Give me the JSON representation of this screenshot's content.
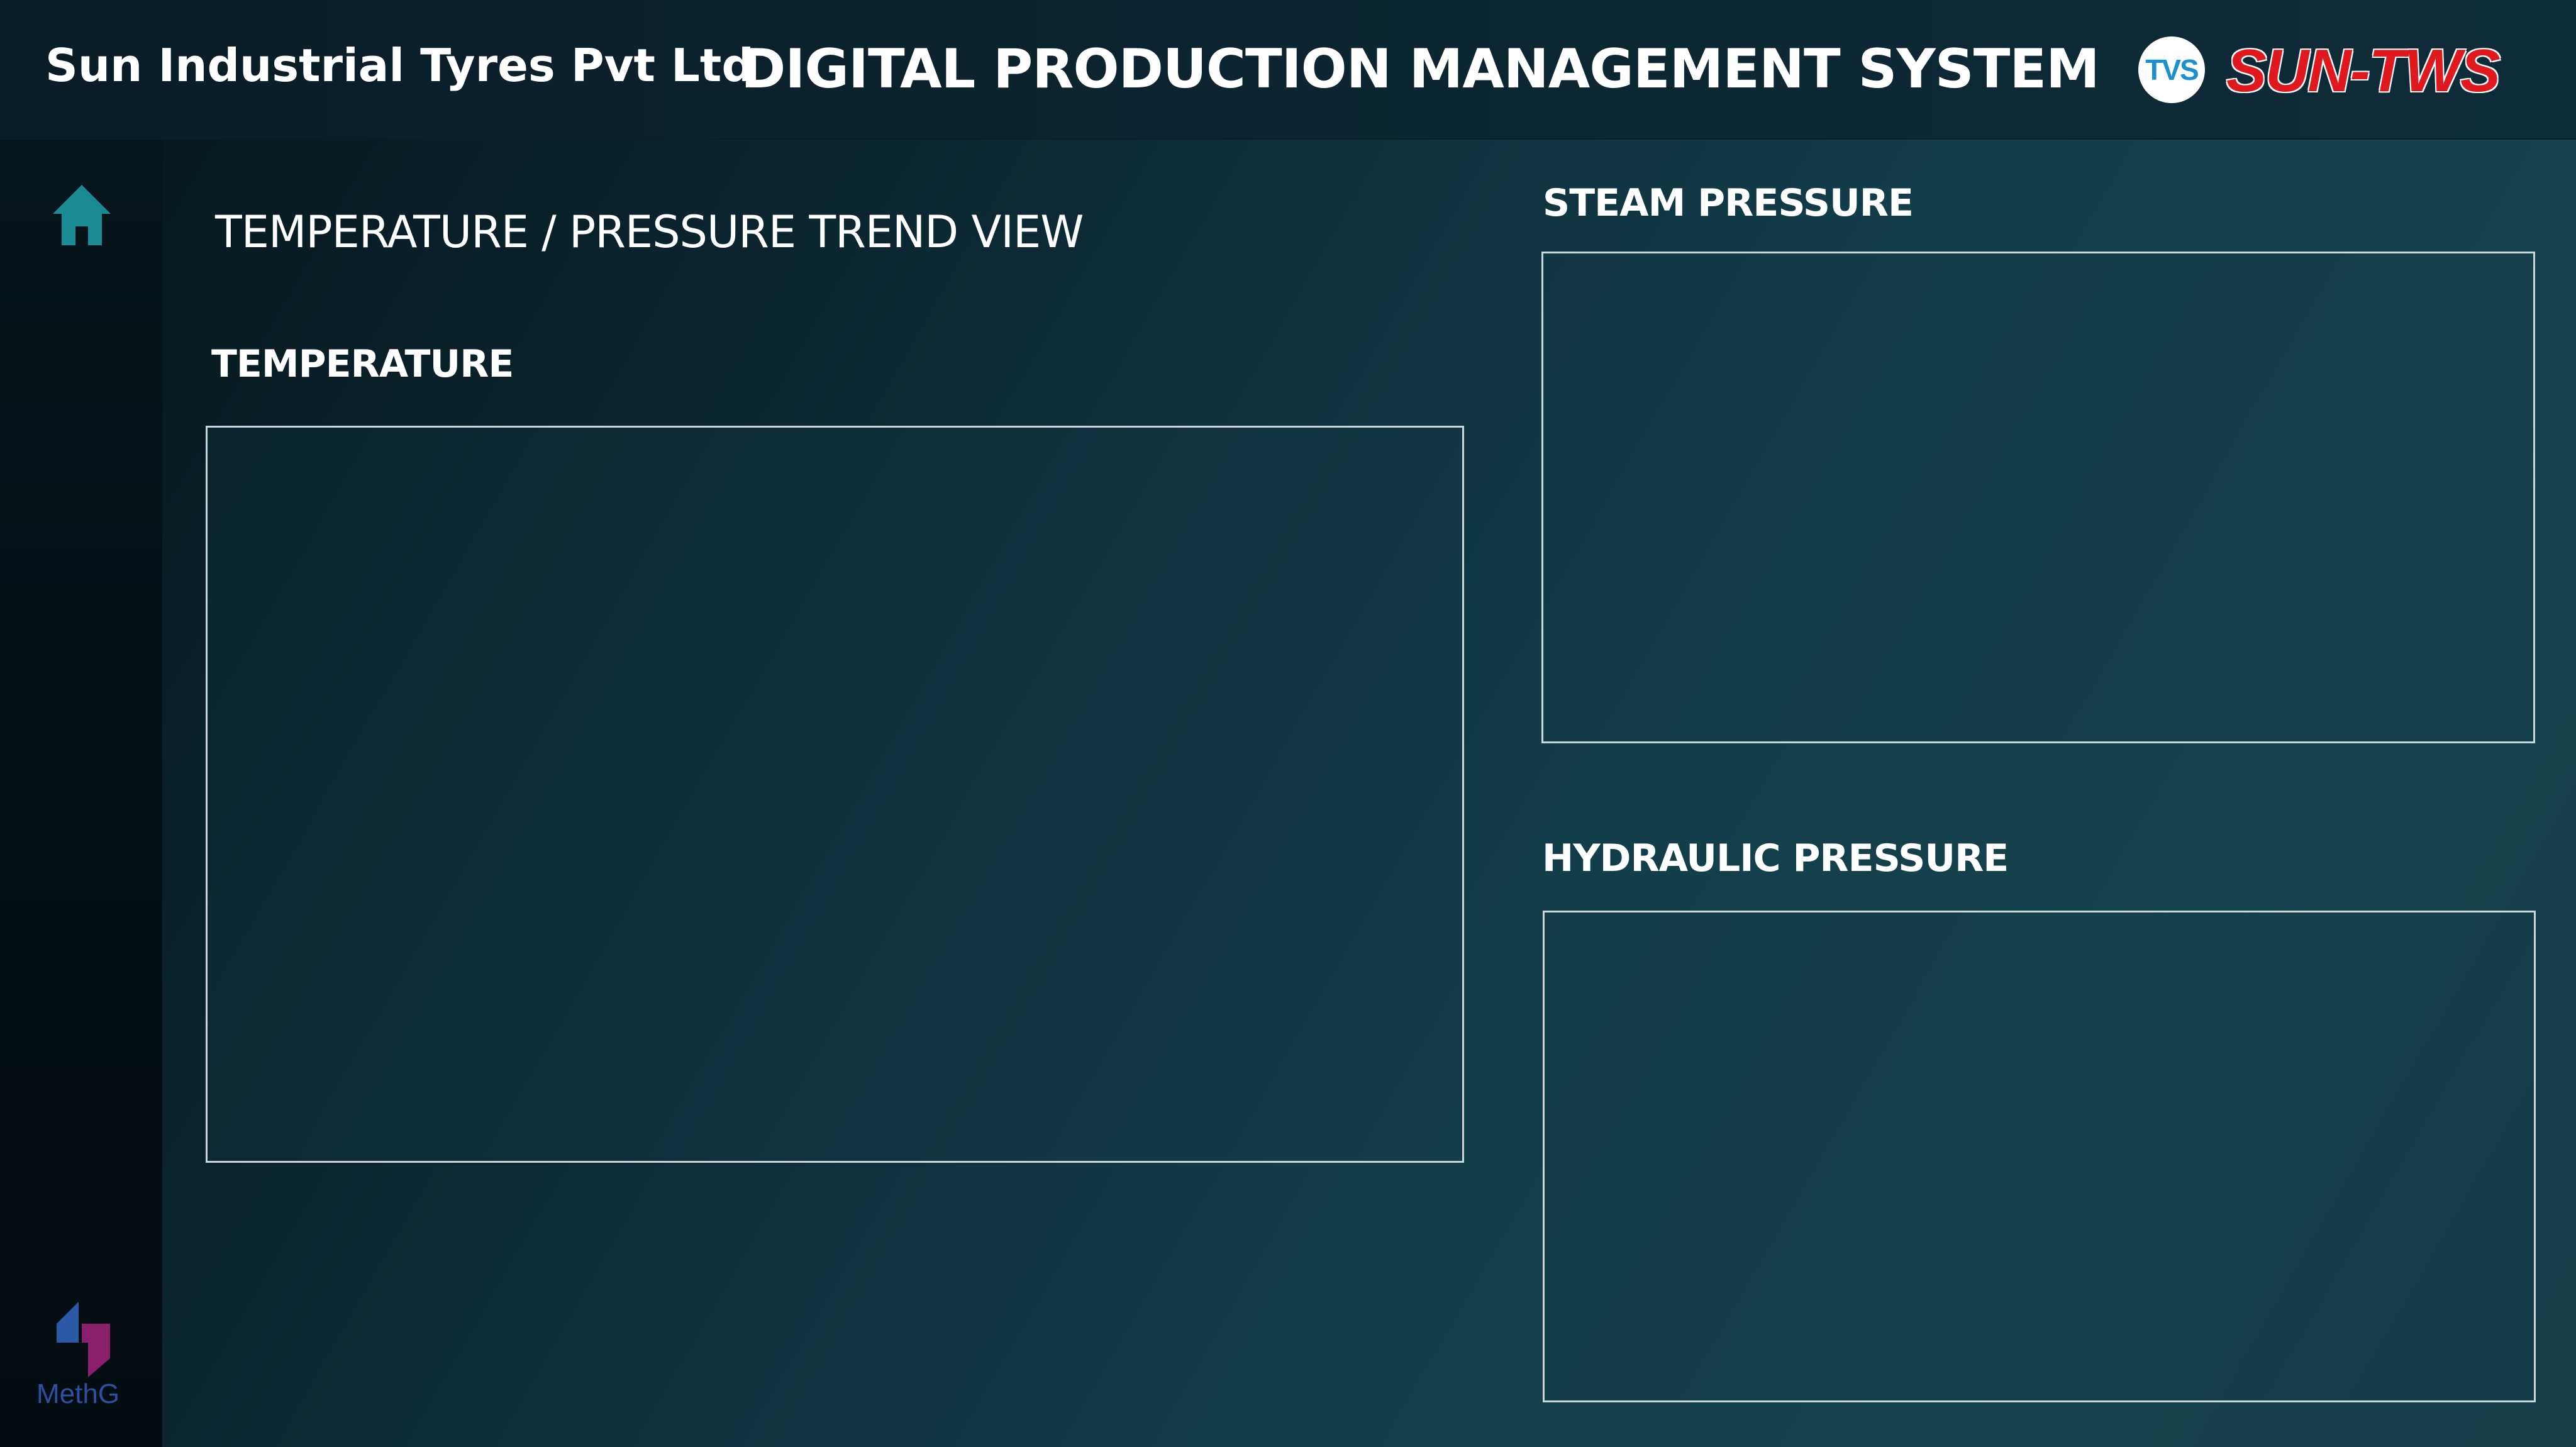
{
  "header": {
    "company_name": "Sun Industrial Tyres Pvt Ltd",
    "system_title": "DIGITAL PRODUCTION MANAGEMENT SYSTEM",
    "logos": {
      "tvs_text": "TVS",
      "brand_text": "SUN-TWS"
    }
  },
  "sidebar": {
    "home_icon": "home-icon",
    "footer_logo_text": "MethG"
  },
  "main": {
    "page_title": "TEMPERATURE / PRESSURE TREND VIEW",
    "panels": [
      {
        "label": "TEMPERATURE"
      },
      {
        "label": "STEAM PRESSURE"
      },
      {
        "label": "HYDRAULIC PRESSURE"
      }
    ]
  },
  "colors": {
    "accent": "#1a8a94",
    "background_dark": "#06141b",
    "background_light": "#163f48",
    "panel_border": "#c9d6da",
    "brand_red": "#e0191e",
    "tvs_blue": "#1c8fd0"
  }
}
